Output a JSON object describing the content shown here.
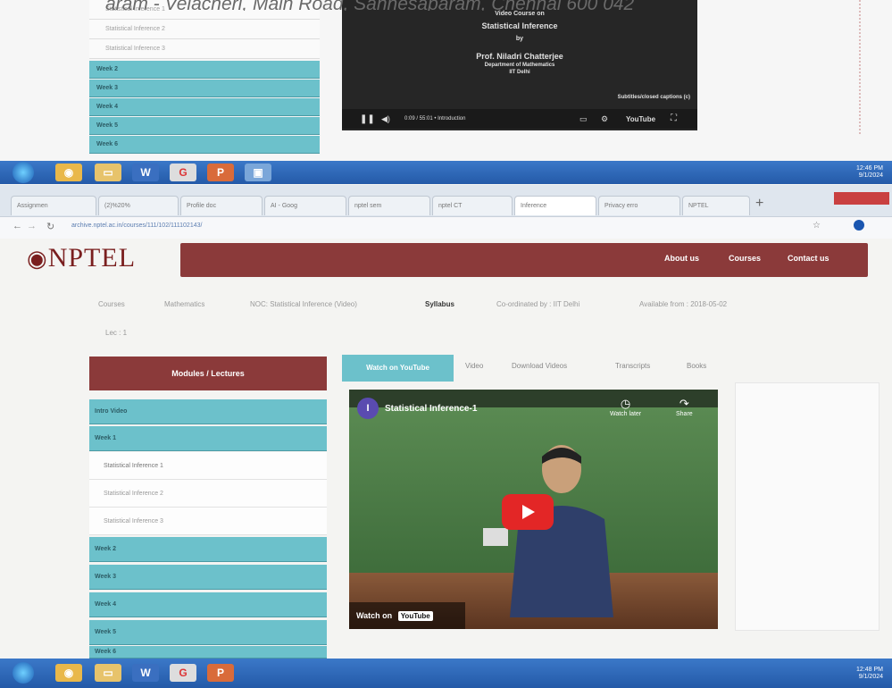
{
  "banner": {
    "text": "aram - Velacheri, Main Road, Sannesaparam, Chennai 600 042"
  },
  "screen1": {
    "lectures": [
      "Statistical Inference 1",
      "Statistical Inference 2",
      "Statistical Inference 3"
    ],
    "weeks": [
      "Week 2",
      "Week 3",
      "Week 4",
      "Week 5",
      "Week 6"
    ],
    "video": {
      "line1": "Video Course on",
      "line2": "Statistical Inference",
      "line3": "by",
      "line4": "Prof. Niladri Chatterjee",
      "line5": "Department of Mathematics",
      "line6": "IIT Delhi",
      "subtitles": "Subtitles/closed captions (c)",
      "time": "0:09 / 55:01 • Introduction",
      "youtube": "YouTube"
    }
  },
  "taskbar1": {
    "time": "12:46 PM",
    "date": "9/1/2024"
  },
  "browser": {
    "tabs": [
      "Assignmen",
      "(2)%20%",
      "Profile doc",
      "AI - Goog",
      "nptel sem",
      "nptel CT",
      "Inference",
      "Privacy erro",
      "NPTEL"
    ],
    "url": "archive.nptel.ac.in/courses/111/102/111102143/"
  },
  "nptel": {
    "logo": "NPTEL",
    "nav": {
      "about": "About us",
      "courses": "Courses",
      "contact": "Contact us"
    },
    "breadcrumb": {
      "courses": "Courses",
      "subject": "Mathematics",
      "course": "NOC: Statistical Inference (Video)",
      "syllabus": "Syllabus",
      "coordinated": "Co-ordinated by : IIT Delhi",
      "available": "Available from : 2018-05-02",
      "lec": "Lec : 1"
    },
    "modules_header": "Modules / Lectures",
    "intro": "Intro Video",
    "week1": "Week 1",
    "lectures": [
      "Statistical Inference 1",
      "Statistical Inference 2",
      "Statistical Inference 3"
    ],
    "weeks": [
      "Week 2",
      "Week 3",
      "Week 4",
      "Week 5",
      "Week 6"
    ],
    "video_tabs": {
      "watch": "Watch on YouTube",
      "video": "Video",
      "download": "Download Videos",
      "transcripts": "Transcripts",
      "books": "Books"
    },
    "player": {
      "channel": "I",
      "title": "Statistical Inference-1",
      "watch_later": "Watch later",
      "share": "Share",
      "watch_on": "Watch on",
      "yt": "YouTube"
    }
  },
  "taskbar2": {
    "time": "12:48 PM",
    "date": "9/1/2024"
  }
}
